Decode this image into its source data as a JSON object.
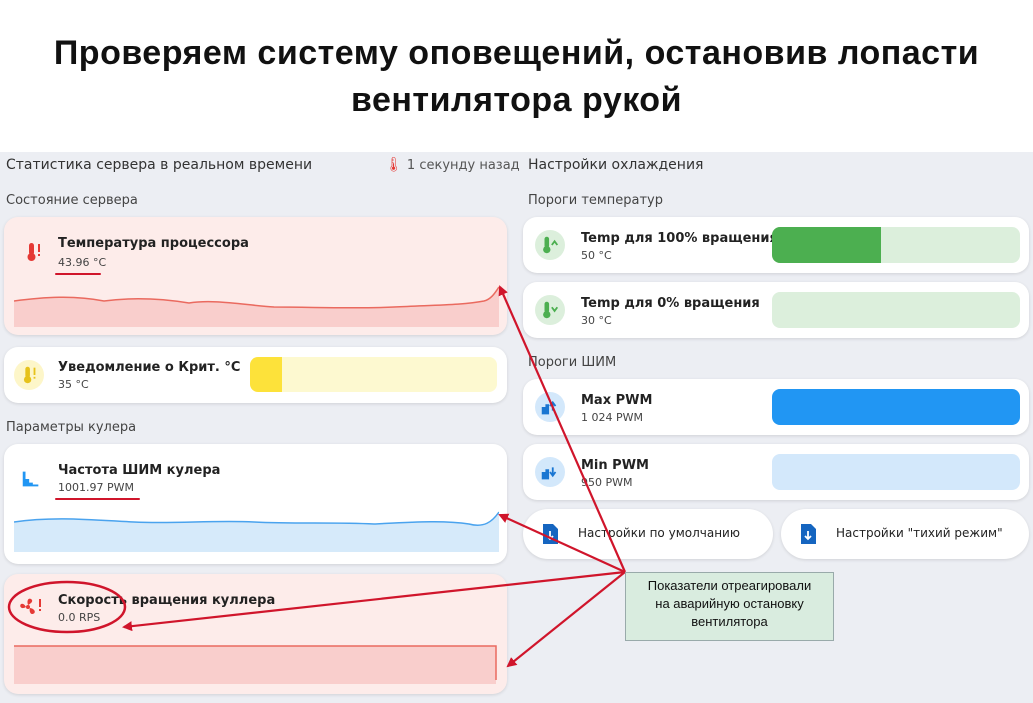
{
  "headline": {
    "line1": "Проверяем систему оповещений, остановив лопасти",
    "line2": "вентилятора рукой"
  },
  "left": {
    "title": "Статистика сервера в реальном времени",
    "timestamp": "1 секунду назад",
    "server_state_title": "Состояние сервера",
    "cpu_temp": {
      "label": "Температура процессора",
      "value": "43.96 °C"
    },
    "crit_notify": {
      "label": "Уведомление о Крит. °C",
      "value": "35 °C",
      "fill": 0.13
    },
    "cooler_params_title": "Параметры кулера",
    "pwm_freq": {
      "label": "Частота ШИМ кулера",
      "value": "1001.97 PWM"
    },
    "fan_speed": {
      "label": "Скорость вращения куллера",
      "value": "0.0 RPS"
    }
  },
  "right": {
    "title": "Настройки охлаждения",
    "temp_thresholds_title": "Пороги температур",
    "temp100": {
      "label": "Temp для 100% вращения",
      "value": "50 °C",
      "fill": 0.44
    },
    "temp0": {
      "label": "Temp для 0% вращения",
      "value": "30 °C",
      "fill": 0.0
    },
    "pwm_thresholds_title": "Пороги ШИМ",
    "max_pwm": {
      "label": "Max PWM",
      "value": "1 024 PWM",
      "fill": 1.0
    },
    "min_pwm": {
      "label": "Min PWM",
      "value": "950 PWM",
      "fill": 0.0
    },
    "default_button": "Настройки по умолчанию",
    "quiet_button": "Настройки \"тихий режим\""
  },
  "callout": {
    "line1": "Показатели отреагировали",
    "line2": "на аварийную остановку",
    "line3": "вентилятора"
  },
  "colors": {
    "alert_red": "#e53935",
    "annotation_red": "#d0152b",
    "green": "#4caf50",
    "green_light": "#dcefdc",
    "blue": "#2196f3",
    "blue_light": "#d3e8fb",
    "yellow": "#fde23a",
    "yellow_light": "#fdf9d0"
  }
}
